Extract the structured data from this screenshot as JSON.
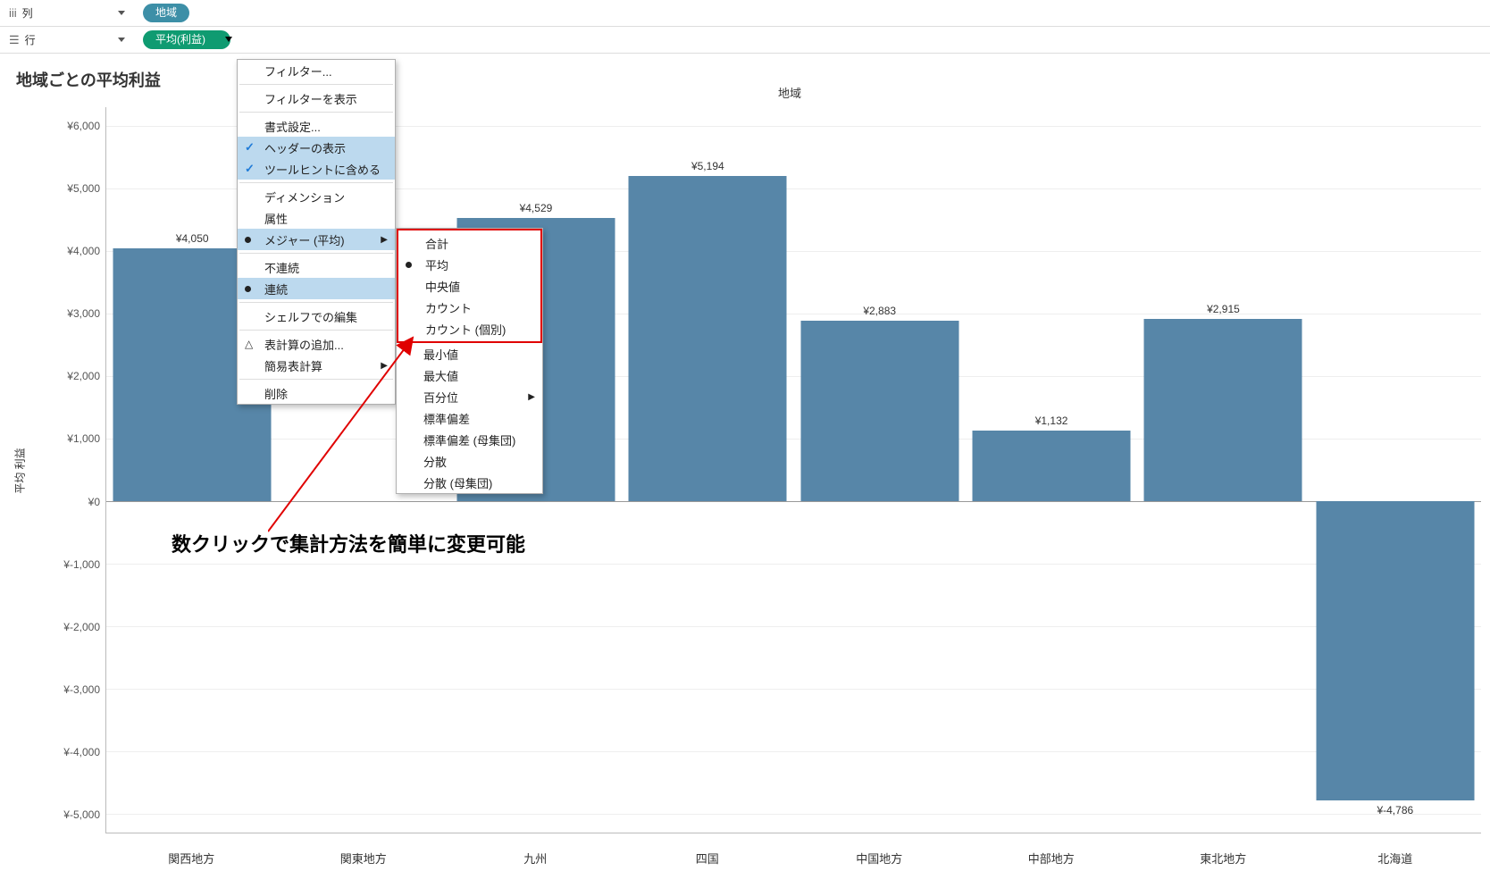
{
  "shelves": {
    "columns": {
      "label": "列",
      "pill": "地域"
    },
    "rows": {
      "label": "行",
      "pill": "平均(利益)"
    }
  },
  "viz": {
    "title": "地域ごとの平均利益",
    "axisTitle": "地域",
    "yAxisLabel": "平均 利益"
  },
  "chart_data": {
    "type": "bar",
    "categories": [
      "関西地方",
      "関東地方",
      "九州",
      "四国",
      "中国地方",
      "中部地方",
      "東北地方",
      "北海道"
    ],
    "values": [
      4050,
      null,
      4529,
      5194,
      2883,
      1132,
      2915,
      -4786
    ],
    "value_labels": [
      "¥4,050",
      "",
      "¥4,529",
      "¥5,194",
      "¥2,883",
      "¥1,132",
      "¥2,915",
      "¥-4,786"
    ],
    "title": "地域ごとの平均利益",
    "xlabel": "地域",
    "ylabel": "平均 利益",
    "yticks": [
      -5000,
      -4000,
      -3000,
      -2000,
      -1000,
      0,
      1000,
      2000,
      3000,
      4000,
      5000,
      6000
    ],
    "ytick_labels": [
      "¥-5,000",
      "¥-4,000",
      "¥-3,000",
      "¥-2,000",
      "¥-1,000",
      "¥0",
      "¥1,000",
      "¥2,000",
      "¥3,000",
      "¥4,000",
      "¥5,000",
      "¥6,000"
    ],
    "ylim": [
      -5300,
      6300
    ]
  },
  "menu1": {
    "filter": "フィルター...",
    "show_filter": "フィルターを表示",
    "format": "書式設定...",
    "show_header": "ヘッダーの表示",
    "tooltip": "ツールヒントに含める",
    "dimension": "ディメンション",
    "attribute": "属性",
    "measure": "メジャー (平均)",
    "discrete": "不連続",
    "continuous": "連続",
    "edit_shelf": "シェルフでの編集",
    "table_calc": "表計算の追加...",
    "quick_table": "簡易表計算",
    "remove": "削除"
  },
  "menu2": {
    "sum": "合計",
    "avg": "平均",
    "median": "中央値",
    "count": "カウント",
    "countd": "カウント (個別)",
    "min": "最小値",
    "max": "最大値",
    "percentile": "百分位",
    "stdev": "標準偏差",
    "stdevp": "標準偏差 (母集団)",
    "var": "分散",
    "varp": "分散 (母集団)"
  },
  "callout": "数クリックで集計方法を簡単に変更可能"
}
